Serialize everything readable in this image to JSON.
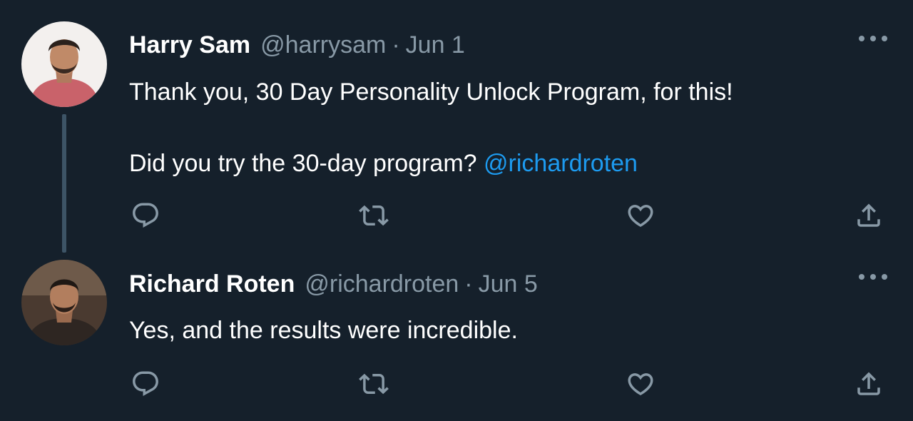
{
  "colors": {
    "background": "#15202b",
    "text_primary": "#ffffff",
    "text_secondary": "#8899a6",
    "link": "#1d9bf0",
    "thread_line": "#3d5466"
  },
  "tweets": [
    {
      "display_name": "Harry Sam",
      "handle": "@harrysam",
      "separator": "·",
      "date": "Jun 1",
      "lines": [
        "Thank you, 30 Day Personality Unlock Program, for this!",
        "Did you try the 30-day program?"
      ],
      "mention": "@richardroten",
      "avatar_icon": "avatar-harry-sam",
      "actions": [
        "reply-icon",
        "retweet-icon",
        "like-icon",
        "share-icon"
      ]
    },
    {
      "display_name": "Richard Roten",
      "handle": "@richardroten",
      "separator": "·",
      "date": "Jun 5",
      "lines": [
        "Yes, and the results were incredible."
      ],
      "avatar_icon": "avatar-richard-roten",
      "actions": [
        "reply-icon",
        "retweet-icon",
        "like-icon",
        "share-icon"
      ]
    }
  ]
}
